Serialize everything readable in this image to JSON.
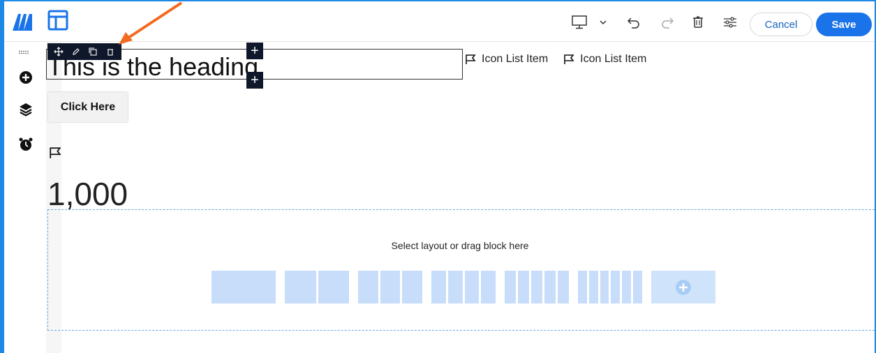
{
  "toolbar": {
    "cancel_label": "Cancel",
    "save_label": "Save",
    "icons": [
      "desktop-icon",
      "chevron-down-icon",
      "undo-icon",
      "redo-icon",
      "trash-icon",
      "sliders-icon"
    ]
  },
  "leftrail": {
    "icons": [
      "grip-icon",
      "add-circle-icon",
      "layers-icon",
      "alarm-clock-icon"
    ]
  },
  "canvas": {
    "heading": "This is the heading",
    "icon_list": [
      {
        "label": "Icon List Item",
        "icon": "flag-icon"
      },
      {
        "label": "Icon List Item",
        "icon": "flag-icon"
      }
    ],
    "button_label": "Click Here",
    "counter": "1,000",
    "dropzone": {
      "label": "Select layout or drag block here",
      "layouts": [
        1,
        2,
        3,
        4,
        5,
        6,
        "custom"
      ]
    }
  },
  "colors": {
    "accent": "#1a73e8",
    "frame": "#1e88e5",
    "arrow": "#f26b21",
    "layout_tile": "#cfe3fb",
    "toolbar_dark": "#0f172a"
  }
}
